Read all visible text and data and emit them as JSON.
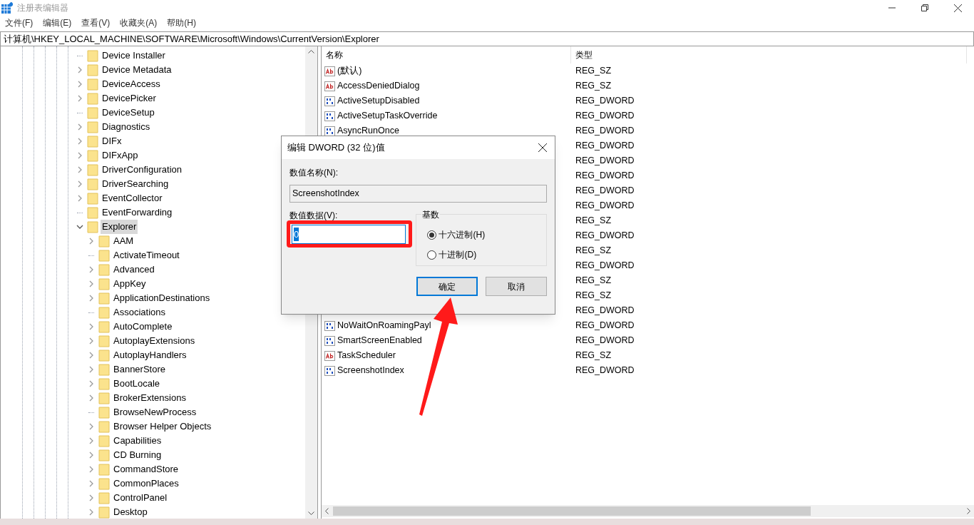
{
  "window": {
    "title": "注册表编辑器"
  },
  "menu": [
    "文件(F)",
    "编辑(E)",
    "查看(V)",
    "收藏夹(A)",
    "帮助(H)"
  ],
  "address": "计算机\\HKEY_LOCAL_MACHINE\\SOFTWARE\\Microsoft\\Windows\\CurrentVersion\\Explorer",
  "tree": [
    {
      "label": "Device Installer",
      "has_children": false,
      "expanded": false,
      "selected": false
    },
    {
      "label": "Device Metadata",
      "has_children": true,
      "expanded": false,
      "selected": false
    },
    {
      "label": "DeviceAccess",
      "has_children": true,
      "expanded": false,
      "selected": false
    },
    {
      "label": "DevicePicker",
      "has_children": true,
      "expanded": false,
      "selected": false
    },
    {
      "label": "DeviceSetup",
      "has_children": false,
      "expanded": false,
      "selected": false
    },
    {
      "label": "Diagnostics",
      "has_children": true,
      "expanded": false,
      "selected": false
    },
    {
      "label": "DIFx",
      "has_children": true,
      "expanded": false,
      "selected": false
    },
    {
      "label": "DIFxApp",
      "has_children": true,
      "expanded": false,
      "selected": false
    },
    {
      "label": "DriverConfiguration",
      "has_children": true,
      "expanded": false,
      "selected": false
    },
    {
      "label": "DriverSearching",
      "has_children": true,
      "expanded": false,
      "selected": false
    },
    {
      "label": "EventCollector",
      "has_children": true,
      "expanded": false,
      "selected": false
    },
    {
      "label": "EventForwarding",
      "has_children": false,
      "expanded": false,
      "selected": false
    },
    {
      "label": "Explorer",
      "has_children": true,
      "expanded": true,
      "selected": true,
      "children": [
        {
          "label": "AAM",
          "has_children": true,
          "expanded": false,
          "selected": false
        },
        {
          "label": "ActivateTimeout",
          "has_children": false,
          "expanded": false,
          "selected": false
        },
        {
          "label": "Advanced",
          "has_children": true,
          "expanded": false,
          "selected": false
        },
        {
          "label": "AppKey",
          "has_children": true,
          "expanded": false,
          "selected": false
        },
        {
          "label": "ApplicationDestinations",
          "has_children": true,
          "expanded": false,
          "selected": false
        },
        {
          "label": "Associations",
          "has_children": false,
          "expanded": false,
          "selected": false
        },
        {
          "label": "AutoComplete",
          "has_children": true,
          "expanded": false,
          "selected": false
        },
        {
          "label": "AutoplayExtensions",
          "has_children": true,
          "expanded": false,
          "selected": false
        },
        {
          "label": "AutoplayHandlers",
          "has_children": true,
          "expanded": false,
          "selected": false
        },
        {
          "label": "BannerStore",
          "has_children": true,
          "expanded": false,
          "selected": false
        },
        {
          "label": "BootLocale",
          "has_children": true,
          "expanded": false,
          "selected": false
        },
        {
          "label": "BrokerExtensions",
          "has_children": true,
          "expanded": false,
          "selected": false
        },
        {
          "label": "BrowseNewProcess",
          "has_children": false,
          "expanded": false,
          "selected": false
        },
        {
          "label": "Browser Helper Objects",
          "has_children": true,
          "expanded": false,
          "selected": false
        },
        {
          "label": "Capabilities",
          "has_children": true,
          "expanded": false,
          "selected": false
        },
        {
          "label": "CD Burning",
          "has_children": true,
          "expanded": false,
          "selected": false
        },
        {
          "label": "CommandStore",
          "has_children": true,
          "expanded": false,
          "selected": false
        },
        {
          "label": "CommonPlaces",
          "has_children": true,
          "expanded": false,
          "selected": false
        },
        {
          "label": "ControlPanel",
          "has_children": true,
          "expanded": false,
          "selected": false
        },
        {
          "label": "Desktop",
          "has_children": true,
          "expanded": false,
          "selected": false
        }
      ]
    }
  ],
  "table": {
    "columns": [
      "名称",
      "类型"
    ],
    "rows": [
      {
        "kind": "string",
        "name": "(默认)",
        "type": "REG_SZ"
      },
      {
        "kind": "string",
        "name": "AccessDeniedDialog",
        "type": "REG_SZ"
      },
      {
        "kind": "dword",
        "name": "ActiveSetupDisabled",
        "type": "REG_DWORD"
      },
      {
        "kind": "dword",
        "name": "ActiveSetupTaskOverride",
        "type": "REG_DWORD"
      },
      {
        "kind": "dword",
        "name": "AsyncRunOnce",
        "type": "REG_DWORD"
      },
      {
        "kind": "hidden",
        "type": "REG_DWORD"
      },
      {
        "kind": "hidden",
        "type": "REG_DWORD"
      },
      {
        "kind": "hidden",
        "type": "REG_DWORD"
      },
      {
        "kind": "hidden",
        "type": "REG_DWORD"
      },
      {
        "kind": "hidden",
        "type": "REG_DWORD"
      },
      {
        "kind": "hidden",
        "type": "REG_SZ"
      },
      {
        "kind": "hidden",
        "type": "REG_DWORD"
      },
      {
        "kind": "hidden",
        "type": "REG_SZ"
      },
      {
        "kind": "hidden",
        "type": "REG_DWORD"
      },
      {
        "kind": "hidden",
        "type": "REG_SZ"
      },
      {
        "kind": "hidden",
        "type": "REG_SZ"
      },
      {
        "kind": "hidden",
        "type": "REG_DWORD"
      },
      {
        "kind": "dword",
        "name": "NoWaitOnRoamingPayl",
        "type": "REG_DWORD"
      },
      {
        "kind": "dword",
        "name": "SmartScreenEnabled",
        "type": "REG_DWORD"
      },
      {
        "kind": "string",
        "name": "TaskScheduler",
        "type": "REG_SZ"
      },
      {
        "kind": "dword",
        "name": "ScreenshotIndex",
        "type": "REG_DWORD"
      }
    ]
  },
  "dialog": {
    "title": "编辑 DWORD (32 位)值",
    "name_label": "数值名称(N):",
    "name_value": "ScreenshotIndex",
    "data_label": "数值数据(V):",
    "data_value": "0",
    "base_label": "基数",
    "radios": [
      {
        "label": "十六进制(H)",
        "selected": true
      },
      {
        "label": "十进制(D)",
        "selected": false
      }
    ],
    "buttons": [
      {
        "label": "确定",
        "selected": true
      },
      {
        "label": "取消",
        "selected": false
      }
    ]
  }
}
